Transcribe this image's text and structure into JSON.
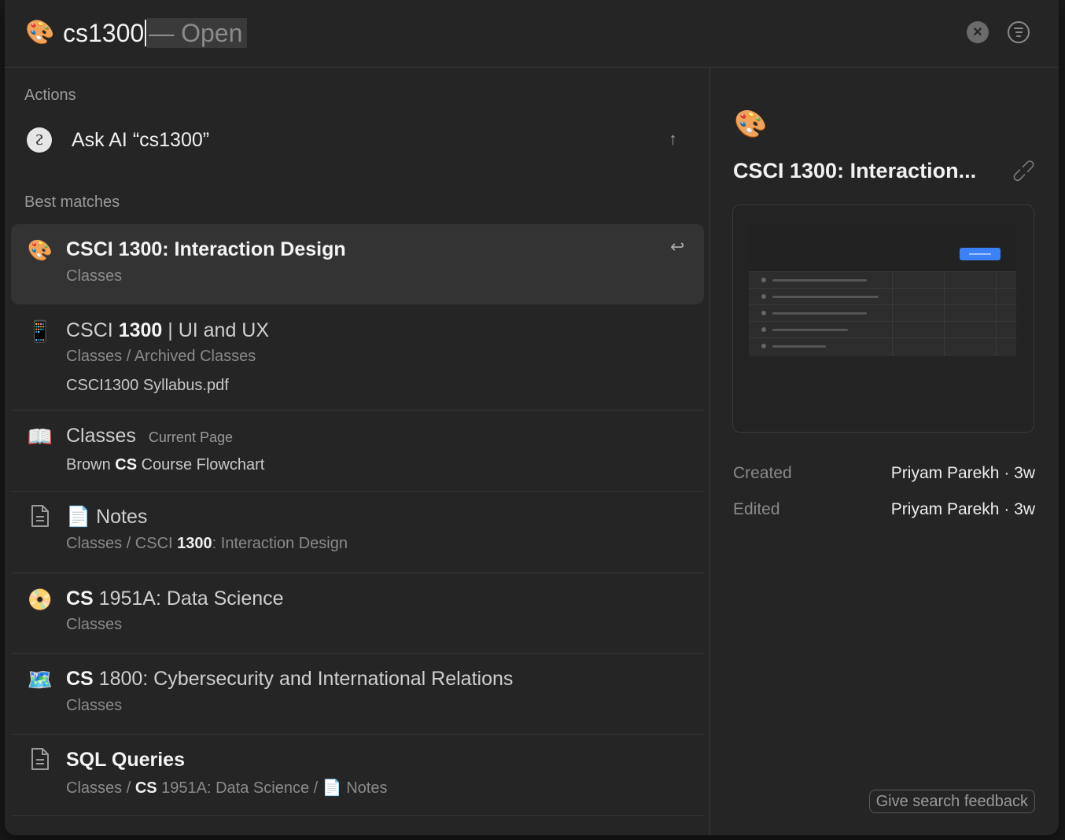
{
  "search": {
    "emoji": "🎨",
    "query": "cs1300",
    "suffix": "— Open"
  },
  "sections": {
    "actions": "Actions",
    "best_matches": "Best matches"
  },
  "ask_ai": {
    "label": "Ask AI",
    "query": "“cs1300”",
    "arrow": "↑"
  },
  "results": [
    {
      "icon": "🎨",
      "title": "CSCI 1300: Interaction Design",
      "sub": "Classes",
      "enter": "↩"
    },
    {
      "icon": "📱",
      "title_pre": "CSCI ",
      "title_bold": "1300",
      "title_post": " | UI and UX",
      "sub": "Classes / Archived Classes",
      "extra": "CSCI1300 Syllabus.pdf"
    },
    {
      "icon": "📖",
      "title": "Classes",
      "badge": "Current Page",
      "extra_pre": "Brown ",
      "extra_bold": "CS",
      "extra_post": " Course Flowchart"
    },
    {
      "icon": "document",
      "title_icon": "📄",
      "title": "Notes",
      "sub_pre": "Classes / CSCI ",
      "sub_bold": "1300",
      "sub_post": ": Interaction Design"
    },
    {
      "icon": "📀",
      "title_bold": "CS",
      "title_post": " 1951A: Data Science",
      "sub": "Classes"
    },
    {
      "icon": "🗺️",
      "title_bold": "CS",
      "title_post": " 1800: Cybersecurity and International Relations",
      "sub": "Classes"
    },
    {
      "icon": "document",
      "title": "SQL Queries",
      "sub_pre": "Classes / ",
      "sub_bold": "CS",
      "sub_post": " 1951A: Data Science / ",
      "sub_icon": "📄",
      "sub_tail": "Notes"
    }
  ],
  "preview": {
    "emoji": "🎨",
    "title": "CSCI 1300: Interaction...",
    "created_label": "Created",
    "created_value": "Priyam Parekh · 3w",
    "edited_label": "Edited",
    "edited_value": "Priyam Parekh · 3w",
    "feedback": "Give search feedback"
  }
}
